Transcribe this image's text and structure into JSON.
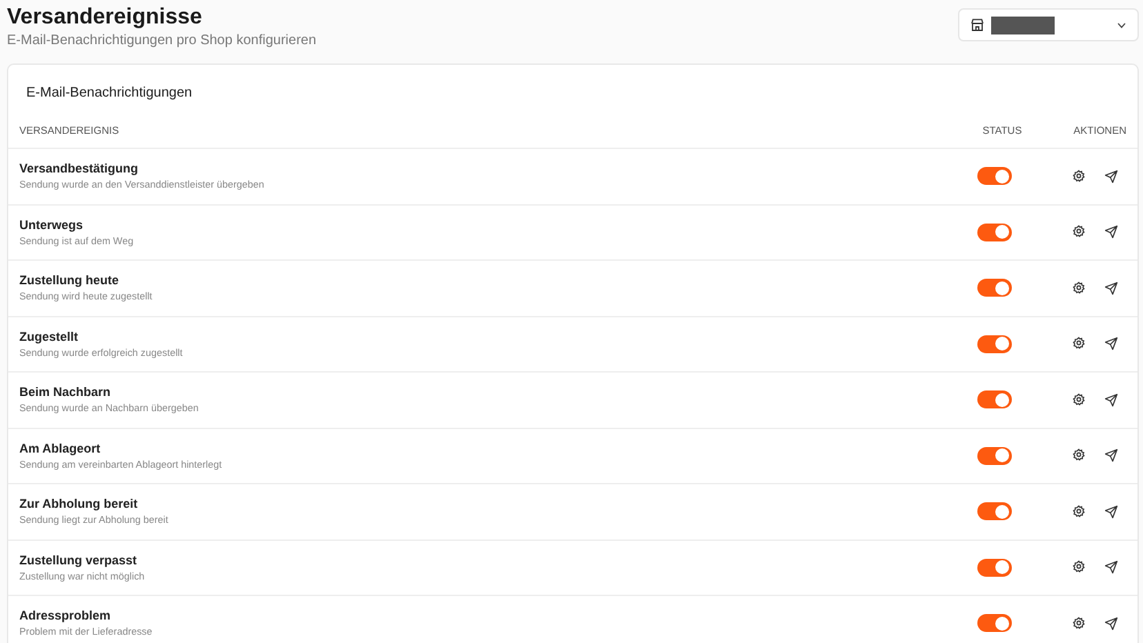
{
  "header": {
    "title": "Versandereignisse",
    "subtitle": "E-Mail-Benachrichtigungen pro Shop konfigurieren"
  },
  "shop_selector": {
    "redacted": true
  },
  "card": {
    "title": "E-Mail-Benachrichtigungen"
  },
  "table": {
    "columns": [
      "VERSANDEREIGNIS",
      "STATUS",
      "AKTIONEN"
    ],
    "rows": [
      {
        "name": "Versandbestätigung",
        "description": "Sendung wurde an den Versanddienstleister übergeben",
        "on": true
      },
      {
        "name": "Unterwegs",
        "description": "Sendung ist auf dem Weg",
        "on": true
      },
      {
        "name": "Zustellung heute",
        "description": "Sendung wird heute zugestellt",
        "on": true
      },
      {
        "name": "Zugestellt",
        "description": "Sendung wurde erfolgreich zugestellt",
        "on": true
      },
      {
        "name": "Beim Nachbarn",
        "description": "Sendung wurde an Nachbarn übergeben",
        "on": true
      },
      {
        "name": "Am Ablageort",
        "description": "Sendung am vereinbarten Ablageort hinterlegt",
        "on": true
      },
      {
        "name": "Zur Abholung bereit",
        "description": "Sendung liegt zur Abholung bereit",
        "on": true
      },
      {
        "name": "Zustellung verpasst",
        "description": "Zustellung war nicht möglich",
        "on": true
      },
      {
        "name": "Adressproblem",
        "description": "Problem mit der Lieferadresse",
        "on": true
      }
    ]
  }
}
